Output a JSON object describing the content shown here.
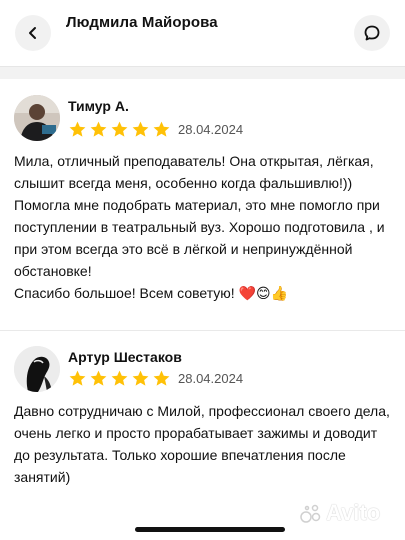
{
  "header": {
    "title": "Людмила Майорова",
    "back_icon": "chevron-left-icon",
    "chat_icon": "chat-bubble-icon"
  },
  "reviews": [
    {
      "author": "Тимур А.",
      "rating": 5,
      "date": "28.04.2024",
      "paragraphs": [
        "Мила, отличный преподаватель! Она открытая, лёгкая, слышит всегда меня, особенно когда фальшивлю!))",
        "Помогла мне подобрать материал, это мне помогло при поступлении в театральный вуз. Хорошо подготовила , и при этом всегда это всё в лёгкой и непринуждённой обстановке!",
        "Спасибо большое! Всем советую! ❤️😊👍"
      ]
    },
    {
      "author": "Артур Шестаков",
      "rating": 5,
      "date": "28.04.2024",
      "paragraphs": [
        "Давно сотрудничаю с Милой, профессионал своего дела, очень легко и просто прорабатывает зажимы и доводит до результата. Только хорошие впечатления после занятий)"
      ]
    }
  ],
  "watermark": {
    "text": "Avito"
  },
  "colors": {
    "star": "#FFC107",
    "button_bg": "#f1f1f1",
    "divider": "#f2f2f2"
  }
}
